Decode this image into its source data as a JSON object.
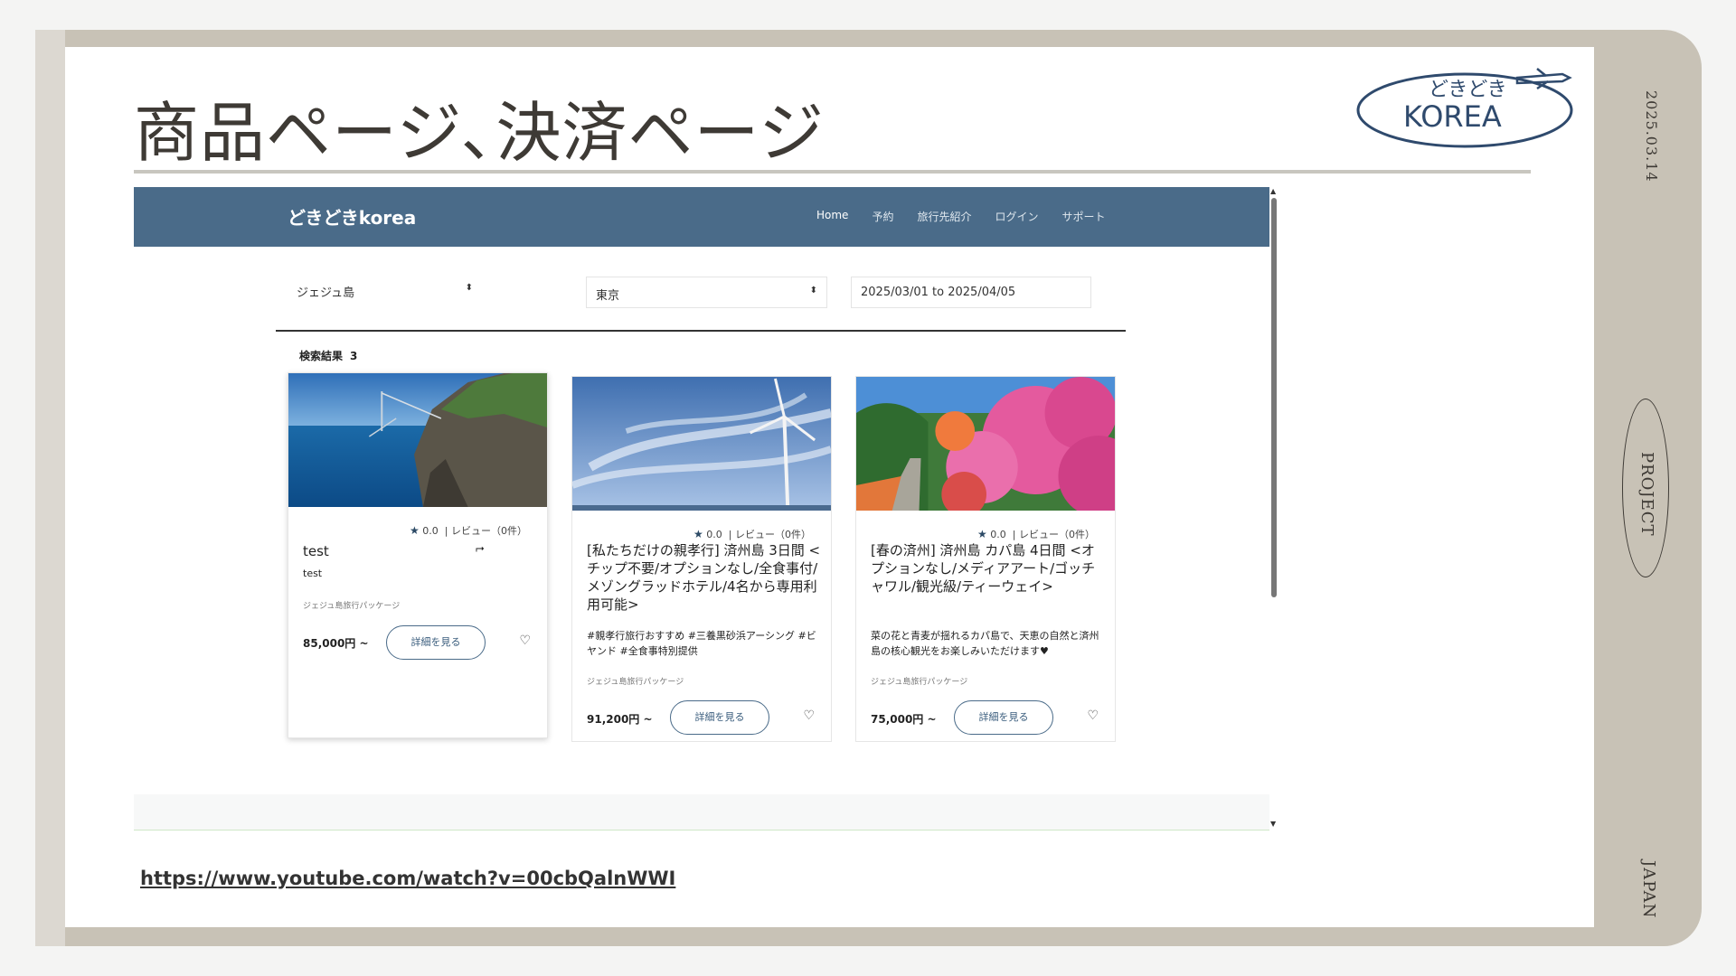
{
  "slide": {
    "title": "商品ページ､決済ページ",
    "date": "2025.03.14",
    "project": "PROJECT",
    "country": "JAPAN",
    "logo_text_top": "どきどき",
    "logo_text_bottom": "KOREA",
    "link": "https://www.youtube.com/watch?v=00cbQalnWWI"
  },
  "site": {
    "brand": "どきどきkorea",
    "nav": [
      "Home",
      "予約",
      "旅行先紹介",
      "ログイン",
      "サポート"
    ],
    "search": {
      "destination": "ジェジュ島",
      "origin": "東京",
      "dates": "2025/03/01 to 2025/04/05"
    },
    "results_label": "検索結果",
    "results_count": "3"
  },
  "cards": [
    {
      "rating": "0.0",
      "reviews": "| レビュー（0件）",
      "title": "test",
      "desc": "test",
      "category": "ジェジュ島旅行パッケージ",
      "price": "85,000円 ~",
      "button": "詳細を見る"
    },
    {
      "rating": "0.0",
      "reviews": "| レビュー（0件）",
      "title": "[私たちだけの親孝行] 済州島 3日間 <チップ不要/オプションなし/全食事付/メゾングラッドホテル/4名から専用利用可能>",
      "desc": "#親孝行旅行おすすめ #三養黒砂浜アーシング #ビヤンド #全食事特別提供",
      "category": "ジェジュ島旅行パッケージ",
      "price": "91,200円 ~",
      "button": "詳細を見る"
    },
    {
      "rating": "0.0",
      "reviews": "| レビュー（0件）",
      "title": "[春の済州] 済州島 カパ島 4日間 <オプションなし/メディアアート/ゴッチャワル/観光級/ティーウェイ>",
      "desc": "菜の花と青麦が揺れるカパ島で、天恵の自然と済州島の核心観光をお楽しみいただけます♥",
      "category": "ジェジュ島旅行パッケージ",
      "price": "75,000円 ~",
      "button": "詳細を見る"
    }
  ],
  "colors": {
    "navbar": "#4a6b89",
    "frame": "#c8c2b6",
    "accent": "#3a5d7d"
  }
}
